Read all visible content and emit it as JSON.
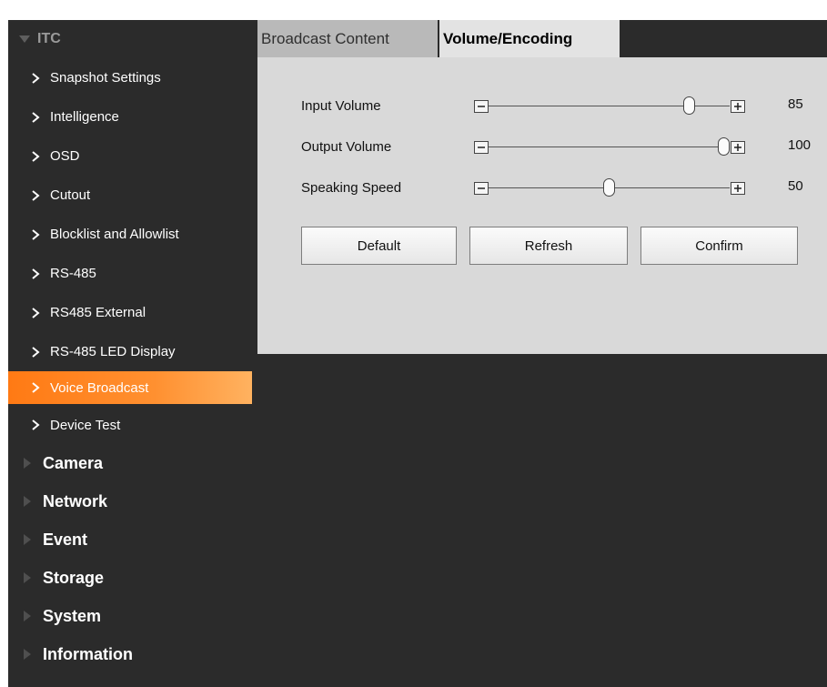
{
  "sidebar": {
    "root": {
      "label": "ITC",
      "icon": "triangle-down-icon"
    },
    "sub_items": [
      {
        "label": "Snapshot Settings",
        "icon": "chevron-right-icon"
      },
      {
        "label": "Intelligence",
        "icon": "chevron-right-icon"
      },
      {
        "label": "OSD",
        "icon": "chevron-right-icon"
      },
      {
        "label": "Cutout",
        "icon": "chevron-right-icon"
      },
      {
        "label": "Blocklist and Allowlist",
        "icon": "chevron-right-icon"
      },
      {
        "label": "RS-485",
        "icon": "chevron-right-icon"
      },
      {
        "label": "RS485 External",
        "icon": "chevron-right-icon"
      },
      {
        "label": "RS-485 LED Display",
        "icon": "chevron-right-icon"
      },
      {
        "label": "Voice Broadcast",
        "icon": "chevron-right-icon",
        "active": true
      },
      {
        "label": "Device Test",
        "icon": "chevron-right-icon"
      }
    ],
    "top_items": [
      {
        "label": "Camera",
        "icon": "triangle-right-icon"
      },
      {
        "label": "Network",
        "icon": "triangle-right-icon"
      },
      {
        "label": "Event",
        "icon": "triangle-right-icon"
      },
      {
        "label": "Storage",
        "icon": "triangle-right-icon"
      },
      {
        "label": "System",
        "icon": "triangle-right-icon"
      },
      {
        "label": "Information",
        "icon": "triangle-right-icon"
      }
    ]
  },
  "tabs": [
    {
      "label": "Broadcast Content",
      "selected": false
    },
    {
      "label": "Volume/Encoding",
      "selected": true
    }
  ],
  "sliders": [
    {
      "label": "Input Volume",
      "value": "85",
      "level": 0.85,
      "minus_icon": "minus-icon",
      "plus_icon": "plus-icon"
    },
    {
      "label": "Output Volume",
      "value": "100",
      "level": 1.0,
      "minus_icon": "minus-icon",
      "plus_icon": "plus-icon"
    },
    {
      "label": "Speaking Speed",
      "value": "50",
      "level": 0.5,
      "minus_icon": "minus-icon",
      "plus_icon": "plus-icon"
    }
  ],
  "buttons": {
    "default_label": "Default",
    "refresh_label": "Refresh",
    "confirm_label": "Confirm"
  },
  "colors": {
    "active_accent": "#ff8a24",
    "sidebar_bg": "#2b2b2b",
    "panel_bg": "#d9d9d9"
  }
}
